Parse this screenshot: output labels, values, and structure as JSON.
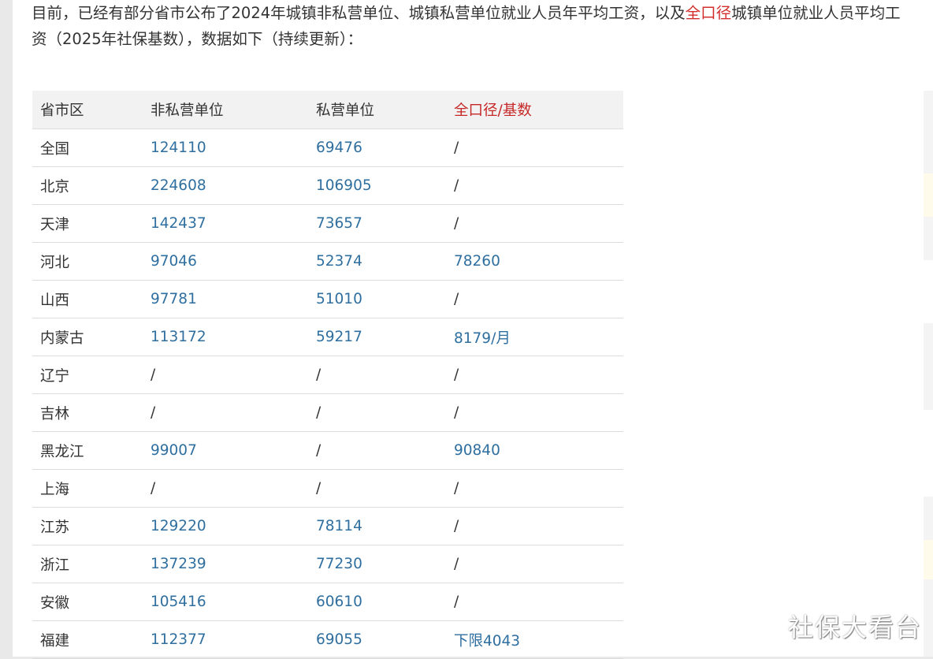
{
  "intro": {
    "before": "目前，已经有部分省市公布了2024年城镇非私营单位、城镇私营单位就业人员年平均工资，以及",
    "highlight": "全口径",
    "after": "城镇单位就业人员平均工资（2025年社保基数），数据如下（持续更新）："
  },
  "table": {
    "headers": [
      "省市区",
      "非私营单位",
      "私营单位",
      "全口径/基数"
    ],
    "rows": [
      [
        "全国",
        "124110",
        "69476",
        "/"
      ],
      [
        "北京",
        "224608",
        "106905",
        "/"
      ],
      [
        "天津",
        "142437",
        "73657",
        "/"
      ],
      [
        "河北",
        "97046",
        "52374",
        "78260"
      ],
      [
        "山西",
        "97781",
        "51010",
        "/"
      ],
      [
        "内蒙古",
        "113172",
        "59217",
        "8179/月"
      ],
      [
        "辽宁",
        "/",
        "/",
        "/"
      ],
      [
        "吉林",
        "/",
        "/",
        "/"
      ],
      [
        "黑龙江",
        "99007",
        "/",
        "90840"
      ],
      [
        "上海",
        "/",
        "/",
        "/"
      ],
      [
        "江苏",
        "129220",
        "78114",
        "/"
      ],
      [
        "浙江",
        "137239",
        "77230",
        "/"
      ],
      [
        "安徽",
        "105416",
        "60610",
        "/"
      ],
      [
        "福建",
        "112377",
        "69055",
        "下限4043"
      ]
    ]
  },
  "watermark": "社保大看台"
}
